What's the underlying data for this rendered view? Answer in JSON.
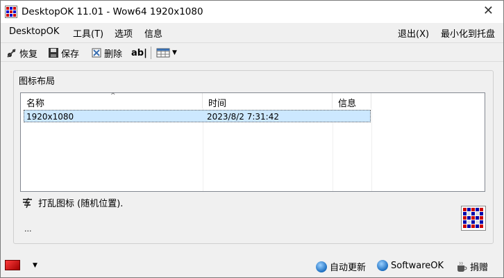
{
  "window": {
    "title": "DesktopOK 11.01 - Wow64 1920x1080",
    "close_label": "✕"
  },
  "menu": {
    "desktopok": "DesktopOK",
    "tools": "工具(T)",
    "options": "选项",
    "info": "信息",
    "exit": "退出(X)",
    "minimize_tray": "最小化到托盘"
  },
  "toolbar": {
    "restore": "恢复",
    "save": "保存",
    "delete": "删除",
    "rename": "ab|"
  },
  "group": {
    "label": "图标布局"
  },
  "table": {
    "headers": [
      "名称",
      "时间",
      "信息"
    ],
    "sort_indicator": "^",
    "rows": [
      {
        "name": "1920x1080",
        "time": "2023/8/2 7:31:42",
        "info": ""
      }
    ]
  },
  "shuffle": {
    "label": "打乱图标 (随机位置)."
  },
  "status_dots": "...",
  "footer": {
    "auto_update": "自动更新",
    "softwareok": "SoftwareOK",
    "donate": "捐赠"
  },
  "colors": {
    "selection": "#cce8ff",
    "accent_red": "#d40000",
    "globe_blue": "#1d6fc1"
  }
}
